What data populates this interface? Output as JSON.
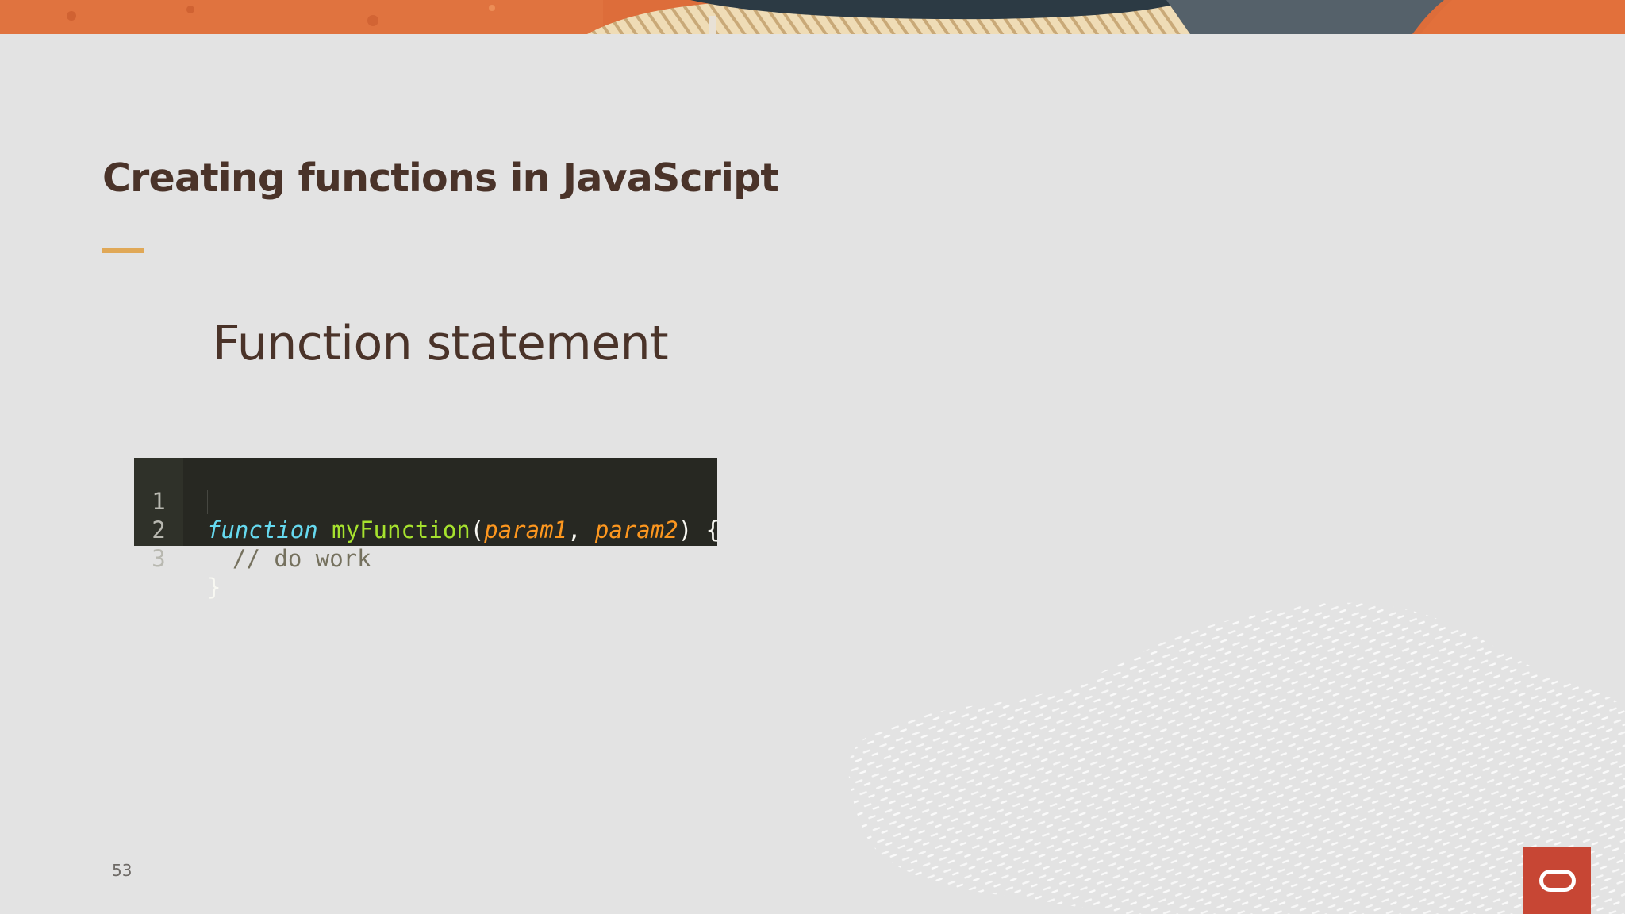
{
  "slide": {
    "title": "Creating functions in JavaScript",
    "subtitle": "Function statement",
    "page_number": "53"
  },
  "code": {
    "lines": [
      {
        "number": "1"
      },
      {
        "number": "2",
        "comment": "// do work"
      },
      {
        "number": "3",
        "close_brace": "}"
      }
    ],
    "tokens": {
      "keyword": "function",
      "function_name": "myFunction",
      "open_paren": "(",
      "param1": "param1",
      "comma": ", ",
      "param2": "param2",
      "close_paren_brace": ") {"
    }
  },
  "colors": {
    "title": "#4a3329",
    "accent": "#e0a857",
    "background": "#e3e3e3",
    "code_background": "#272822",
    "logo_red": "#c74634"
  },
  "icons": {
    "logo": "oracle-logo-icon"
  }
}
